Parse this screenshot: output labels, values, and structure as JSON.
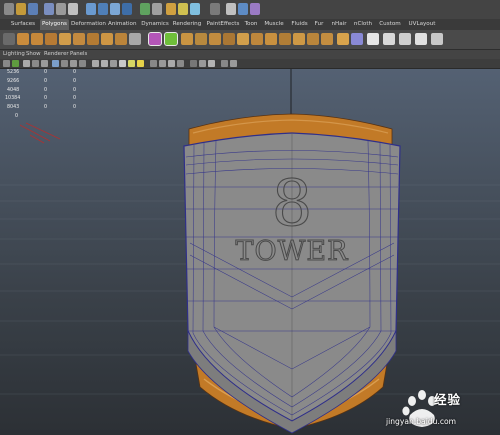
{
  "shelf": {
    "tabs": [
      {
        "label": "Surfaces",
        "active": false
      },
      {
        "label": "Polygons",
        "active": true
      },
      {
        "label": "Deformation",
        "active": false
      },
      {
        "label": "Animation",
        "active": false
      },
      {
        "label": "Dynamics",
        "active": false
      },
      {
        "label": "Rendering",
        "active": false
      },
      {
        "label": "PaintEffects",
        "active": false
      },
      {
        "label": "Toon",
        "active": false
      },
      {
        "label": "Muscle",
        "active": false
      },
      {
        "label": "Fluids",
        "active": false
      },
      {
        "label": "Fur",
        "active": false
      },
      {
        "label": "nHair",
        "active": false
      },
      {
        "label": "nCloth",
        "active": false
      },
      {
        "label": "Custom",
        "active": false
      },
      {
        "label": "UVLayout",
        "active": false
      }
    ]
  },
  "panel_menu": {
    "items": [
      "Lighting",
      "Show",
      "Renderer",
      "Panels"
    ]
  },
  "hud": {
    "rows": [
      [
        "5236",
        "0",
        "0"
      ],
      [
        "9266",
        "0",
        "0"
      ],
      [
        "4048",
        "0",
        "0"
      ],
      [
        "10384",
        "0",
        "0"
      ],
      [
        "8043",
        "0",
        "0"
      ],
      [
        "0",
        "",
        ""
      ]
    ]
  },
  "model": {
    "number": "8",
    "word": "TOWER"
  },
  "watermark": {
    "brand": "经验",
    "url": "jingyan.baidu.com"
  },
  "colors": {
    "wireframe": "#2f2f8a",
    "wood": "#c07a2a",
    "accent_selected": "#6fbf3a"
  }
}
